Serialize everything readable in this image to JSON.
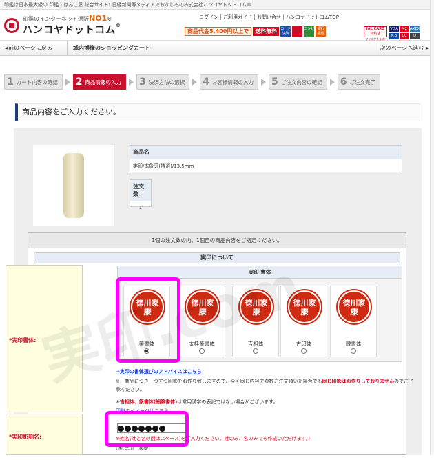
{
  "top_bar": {
    "text": "印鑑は日本最大級の 印鑑・はんこ屋 総合サイト! 日経新聞等メディアでおなじみの株式会社ハンコヤドットコム®"
  },
  "header": {
    "tagline_prefix": "印鑑のインターネット通販",
    "tagline_rank": "NO1",
    "tagline_mark": "※",
    "logo": "ハンコヤドットコム",
    "logo_mark": "®",
    "links": [
      "ログイン",
      "ご利用ガイド",
      "お問い合せ",
      "ハンコヤドットコムTOP"
    ],
    "promo": "商品代金5,400円以上で",
    "promo_free": "送料無料",
    "payments": [
      {
        "l1": "カード",
        "l2": "決済",
        "color": "blue"
      },
      {
        "l1": "代金",
        "l2": "引換",
        "color": "red"
      },
      {
        "l1": "コンビニ",
        "l2": "決済",
        "color": "green"
      },
      {
        "l1": "銀行",
        "l2": "振込",
        "color": "orange"
      }
    ],
    "jal_l1": "JAL CARD",
    "jal_l2": "特約店",
    "jal_l3": "マイルがたまる!",
    "cards_row1": [
      "VISA",
      "MC",
      "AMEX"
    ],
    "cards_row2": [
      "JCB",
      "DC",
      "D"
    ]
  },
  "nav": {
    "back": "◄前のページに戻る",
    "title": "城内博様のショッピングカート",
    "next": "次のページへ進む ►"
  },
  "steps": [
    {
      "num": "1",
      "label": "カート内容の確認"
    },
    {
      "num": "2",
      "label": "商品情報の入力"
    },
    {
      "num": "3",
      "label": "決済方法の選択"
    },
    {
      "num": "4",
      "label": "お客様情報の入力"
    },
    {
      "num": "5",
      "label": "ご注文内容の確認"
    },
    {
      "num": "6",
      "label": "ご注文完了"
    }
  ],
  "banner": "商品内容をご入力ください。",
  "product": {
    "name_label": "商品名",
    "name_value": "実印/本象牙(特選)/13.5mm",
    "qty_label": "注文数",
    "qty_value": "1"
  },
  "form": {
    "caption": "1個の注文数の内、1個目の商品内容をご指定ください。",
    "section": "実印について",
    "font_label": "*実印書体:",
    "font_box_title": "実印 書体",
    "font_options": [
      {
        "name": "篆書体",
        "seal": "徳川家康",
        "selected": true
      },
      {
        "name": "太枠篆書体",
        "seal": "徳川家康",
        "selected": false
      },
      {
        "name": "吉相体",
        "seal": "徳川家康",
        "selected": false
      },
      {
        "name": "古印体",
        "seal": "徳川家康",
        "selected": false
      },
      {
        "name": "隷書体",
        "seal": "徳川家康",
        "selected": false
      }
    ],
    "advice_link": "実印の書体選びのアドバイスはこちら",
    "note1_a": "※一商品につき一つずつ印影をお作り致しますので、全く同じ内容で複数ご注文頂いた場合でも",
    "note1_b": "同じ印影はお作りしておりません",
    "note1_c": "のでご了承ください。",
    "note2_a": "※",
    "note2_b": "吉相体、篆書体(細篆書体)",
    "note2_c": "は常用漢字の表記ではない場合がございます。",
    "note3": "印影のイメージはこちら",
    "name_label": "*実印彫刻名:",
    "name_note_a": "※姓名(姓と名の間はスペース)",
    "name_note_b": "をご入力ください。姓のみ、名のみでも作成いただけます。)",
    "example": "(例:徳川　家康)"
  },
  "watermark": "実印.com",
  "colors": {
    "accent": "#c8102e",
    "highlight": "#ff00ff",
    "link": "#1f3bd0",
    "nav_blue": "#1f3b80"
  }
}
